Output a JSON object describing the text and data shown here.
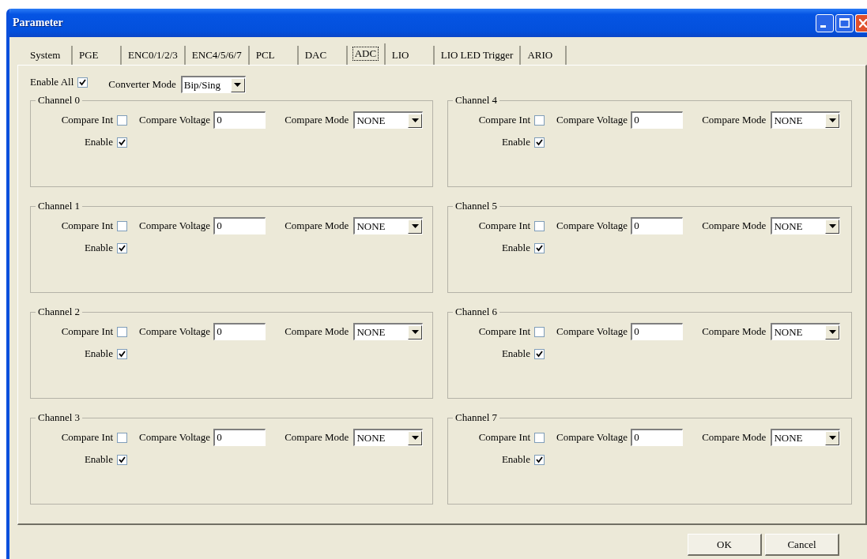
{
  "window": {
    "title": "Parameter"
  },
  "tabs": [
    {
      "label": "System",
      "selected": false
    },
    {
      "label": "PGE",
      "selected": false
    },
    {
      "label": "ENC0/1/2/3",
      "selected": false
    },
    {
      "label": "ENC4/5/6/7",
      "selected": false
    },
    {
      "label": "PCL",
      "selected": false
    },
    {
      "label": "DAC",
      "selected": false
    },
    {
      "label": "ADC",
      "selected": true
    },
    {
      "label": "LIO",
      "selected": false
    },
    {
      "label": "LIO LED Trigger",
      "selected": false
    },
    {
      "label": "ARIO",
      "selected": false
    }
  ],
  "enable_all": {
    "label": "Enable All",
    "checked": true
  },
  "converter_mode": {
    "label": "Converter Mode",
    "value": "Bip/Sing"
  },
  "channels": [
    {
      "title": "Channel 0",
      "compare_int": {
        "label": "Compare Int",
        "checked": false
      },
      "compare_voltage": {
        "label": "Compare Voltage",
        "value": "0"
      },
      "compare_mode": {
        "label": "Compare Mode",
        "value": "NONE"
      },
      "enable": {
        "label": "Enable",
        "checked": true
      }
    },
    {
      "title": "Channel 4",
      "compare_int": {
        "label": "Compare Int",
        "checked": false
      },
      "compare_voltage": {
        "label": "Compare Voltage",
        "value": "0"
      },
      "compare_mode": {
        "label": "Compare Mode",
        "value": "NONE"
      },
      "enable": {
        "label": "Enable",
        "checked": true
      }
    },
    {
      "title": "Channel 1",
      "compare_int": {
        "label": "Compare Int",
        "checked": false
      },
      "compare_voltage": {
        "label": "Compare Voltage",
        "value": "0"
      },
      "compare_mode": {
        "label": "Compare Mode",
        "value": "NONE"
      },
      "enable": {
        "label": "Enable",
        "checked": true
      }
    },
    {
      "title": "Channel 5",
      "compare_int": {
        "label": "Compare Int",
        "checked": false
      },
      "compare_voltage": {
        "label": "Compare Voltage",
        "value": "0"
      },
      "compare_mode": {
        "label": "Compare Mode",
        "value": "NONE"
      },
      "enable": {
        "label": "Enable",
        "checked": true
      }
    },
    {
      "title": "Channel 2",
      "compare_int": {
        "label": "Compare Int",
        "checked": false
      },
      "compare_voltage": {
        "label": "Compare Voltage",
        "value": "0"
      },
      "compare_mode": {
        "label": "Compare Mode",
        "value": "NONE"
      },
      "enable": {
        "label": "Enable",
        "checked": true
      }
    },
    {
      "title": "Channel 6",
      "compare_int": {
        "label": "Compare Int",
        "checked": false
      },
      "compare_voltage": {
        "label": "Compare Voltage",
        "value": "0"
      },
      "compare_mode": {
        "label": "Compare Mode",
        "value": "NONE"
      },
      "enable": {
        "label": "Enable",
        "checked": true
      }
    },
    {
      "title": "Channel 3",
      "compare_int": {
        "label": "Compare Int",
        "checked": false
      },
      "compare_voltage": {
        "label": "Compare Voltage",
        "value": "0"
      },
      "compare_mode": {
        "label": "Compare Mode",
        "value": "NONE"
      },
      "enable": {
        "label": "Enable",
        "checked": true
      }
    },
    {
      "title": "Channel 7",
      "compare_int": {
        "label": "Compare Int",
        "checked": false
      },
      "compare_voltage": {
        "label": "Compare Voltage",
        "value": "0"
      },
      "compare_mode": {
        "label": "Compare Mode",
        "value": "NONE"
      },
      "enable": {
        "label": "Enable",
        "checked": true
      }
    }
  ],
  "buttons": [
    "OK",
    "Cancel"
  ]
}
